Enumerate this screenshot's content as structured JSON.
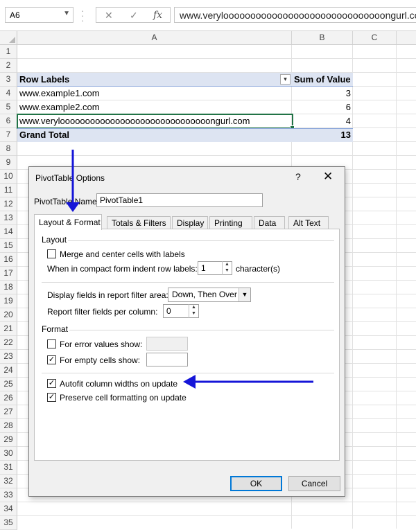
{
  "formula_bar": {
    "name_box": "A6",
    "cancel": "✕",
    "enter": "✓",
    "fx": "fx",
    "content": "www.veryloooooooooooooooooooooooooooooongurl.com"
  },
  "columns": [
    "A",
    "B",
    "C"
  ],
  "rows": [
    "1",
    "2",
    "3",
    "4",
    "5",
    "6",
    "7",
    "8",
    "9",
    "10",
    "11",
    "12",
    "13",
    "14",
    "15",
    "16",
    "17",
    "18",
    "19",
    "20",
    "21",
    "22",
    "23",
    "24",
    "25",
    "26",
    "27",
    "28",
    "29",
    "30",
    "31",
    "32",
    "33",
    "34",
    "35"
  ],
  "pivot": {
    "header_label": "Row Labels",
    "header_value": "Sum of Value",
    "filter_icon": "▾",
    "items": [
      {
        "label": "www.example1.com",
        "value": "3"
      },
      {
        "label": "www.example2.com",
        "value": "6"
      },
      {
        "label": "www.veryloooooooooooooooooooooooooooooongurl.com",
        "value": "4"
      }
    ],
    "total_label": "Grand Total",
    "total_value": "13"
  },
  "dialog": {
    "title": "PivotTable Options",
    "help": "?",
    "close": "✕",
    "name_label": "PivotTable Name:",
    "name_value": "PivotTable1",
    "tabs": [
      "Layout & Format",
      "Totals & Filters",
      "Display",
      "Printing",
      "Data",
      "Alt Text"
    ],
    "layout": {
      "section": "Layout",
      "merge_label": "Merge and center cells with labels",
      "indent_label": "When in compact form indent row labels:",
      "indent_value": "1",
      "indent_unit": "character(s)",
      "display_fields_label": "Display fields in report filter area:",
      "display_fields_value": "Down, Then Over",
      "filter_per_col_label": "Report filter fields per column:",
      "filter_per_col_value": "0"
    },
    "format": {
      "section": "Format",
      "error_label": "For error values show:",
      "empty_label": "For empty cells show:",
      "autofit_label": "Autofit column widths on update",
      "preserve_label": "Preserve cell formatting on update"
    },
    "ok": "OK",
    "cancel": "Cancel"
  },
  "colors": {
    "pivot_band": "#dde4f2",
    "selection": "#217346",
    "annotation_arrow": "#0000ee"
  }
}
